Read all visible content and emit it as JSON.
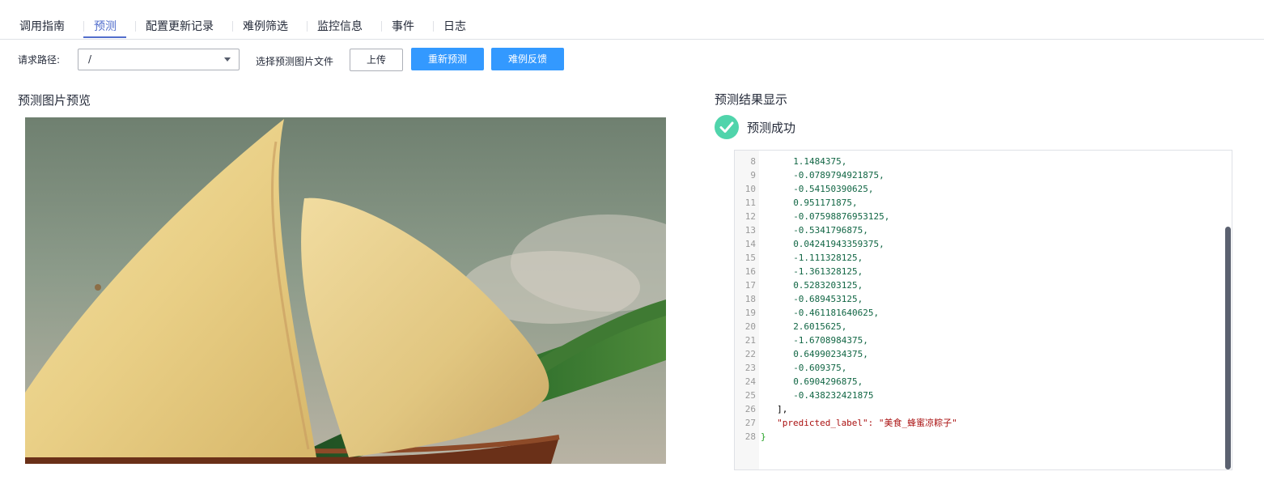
{
  "tabs": [
    {
      "label": "调用指南"
    },
    {
      "label": "预测"
    },
    {
      "label": "配置更新记录"
    },
    {
      "label": "难例筛选"
    },
    {
      "label": "监控信息"
    },
    {
      "label": "事件"
    },
    {
      "label": "日志"
    }
  ],
  "active_tab": "预测",
  "toolbar": {
    "path_label": "请求路径:",
    "path_value": "/",
    "file_label": "选择预测图片文件",
    "upload_label": "上传",
    "repredict_label": "重新预测",
    "hard_feedback_label": "难例反馈"
  },
  "preview": {
    "title": "预测图片预览"
  },
  "result": {
    "title": "预测结果显示",
    "status": "预测成功",
    "status_color": "#50d4ab"
  },
  "code": [
    {
      "ln": "8",
      "text": "1.1484375,",
      "indent": 6,
      "kind": "num"
    },
    {
      "ln": "9",
      "text": "-0.0789794921875,",
      "indent": 6,
      "kind": "num"
    },
    {
      "ln": "10",
      "text": "-0.54150390625,",
      "indent": 6,
      "kind": "num"
    },
    {
      "ln": "11",
      "text": "0.951171875,",
      "indent": 6,
      "kind": "num"
    },
    {
      "ln": "12",
      "text": "-0.07598876953125,",
      "indent": 6,
      "kind": "num"
    },
    {
      "ln": "13",
      "text": "-0.5341796875,",
      "indent": 6,
      "kind": "num"
    },
    {
      "ln": "14",
      "text": "0.04241943359375,",
      "indent": 6,
      "kind": "num"
    },
    {
      "ln": "15",
      "text": "-1.111328125,",
      "indent": 6,
      "kind": "num"
    },
    {
      "ln": "16",
      "text": "-1.361328125,",
      "indent": 6,
      "kind": "num"
    },
    {
      "ln": "17",
      "text": "0.5283203125,",
      "indent": 6,
      "kind": "num"
    },
    {
      "ln": "18",
      "text": "-0.689453125,",
      "indent": 6,
      "kind": "num"
    },
    {
      "ln": "19",
      "text": "-0.461181640625,",
      "indent": 6,
      "kind": "num"
    },
    {
      "ln": "20",
      "text": "2.6015625,",
      "indent": 6,
      "kind": "num"
    },
    {
      "ln": "21",
      "text": "-1.6708984375,",
      "indent": 6,
      "kind": "num"
    },
    {
      "ln": "22",
      "text": "0.64990234375,",
      "indent": 6,
      "kind": "num"
    },
    {
      "ln": "23",
      "text": "-0.609375,",
      "indent": 6,
      "kind": "num"
    },
    {
      "ln": "24",
      "text": "0.6904296875,",
      "indent": 6,
      "kind": "num"
    },
    {
      "ln": "25",
      "text": "-0.438232421875",
      "indent": 6,
      "kind": "num"
    },
    {
      "ln": "26",
      "text": "],",
      "indent": 3,
      "kind": "punct"
    },
    {
      "ln": "27",
      "text": "\"predicted_label\": \"美食_蜂蜜凉粽子\"",
      "indent": 3,
      "kind": "kv"
    },
    {
      "ln": "28",
      "text": "}",
      "indent": 0,
      "kind": "brace"
    }
  ]
}
